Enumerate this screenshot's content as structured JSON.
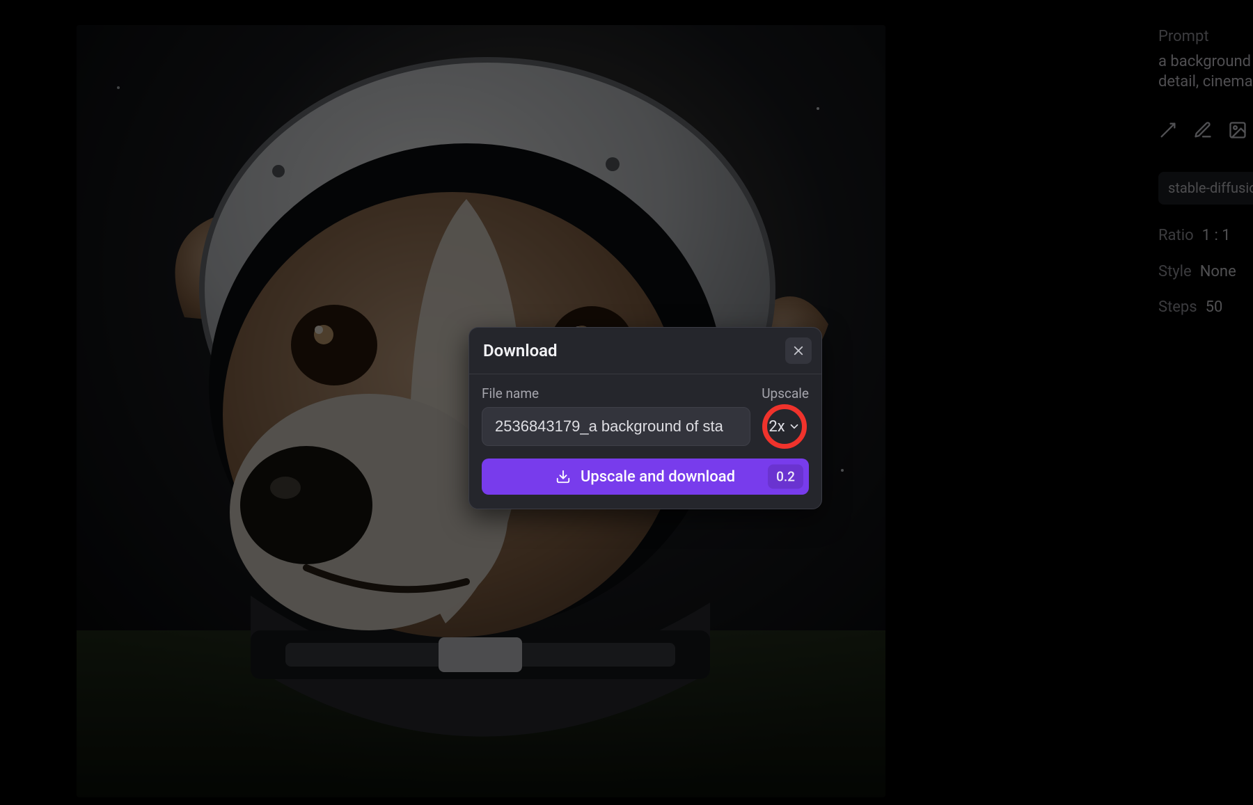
{
  "sidebar": {
    "prompt_label": "Prompt",
    "prompt_text": "a background\ndetail, cinema",
    "model_tag": "stable-diffusion",
    "ratio_label": "Ratio",
    "ratio_value": "1 : 1",
    "style_label": "Style",
    "style_value": "None",
    "steps_label": "Steps",
    "steps_value": "50"
  },
  "dialog": {
    "title": "Download",
    "filename_label": "File name",
    "filename_value": "2536843179_a background of sta",
    "upscale_label": "Upscale",
    "upscale_value": "2x",
    "download_button_label": "Upscale and download",
    "download_button_badge": "0.2"
  }
}
